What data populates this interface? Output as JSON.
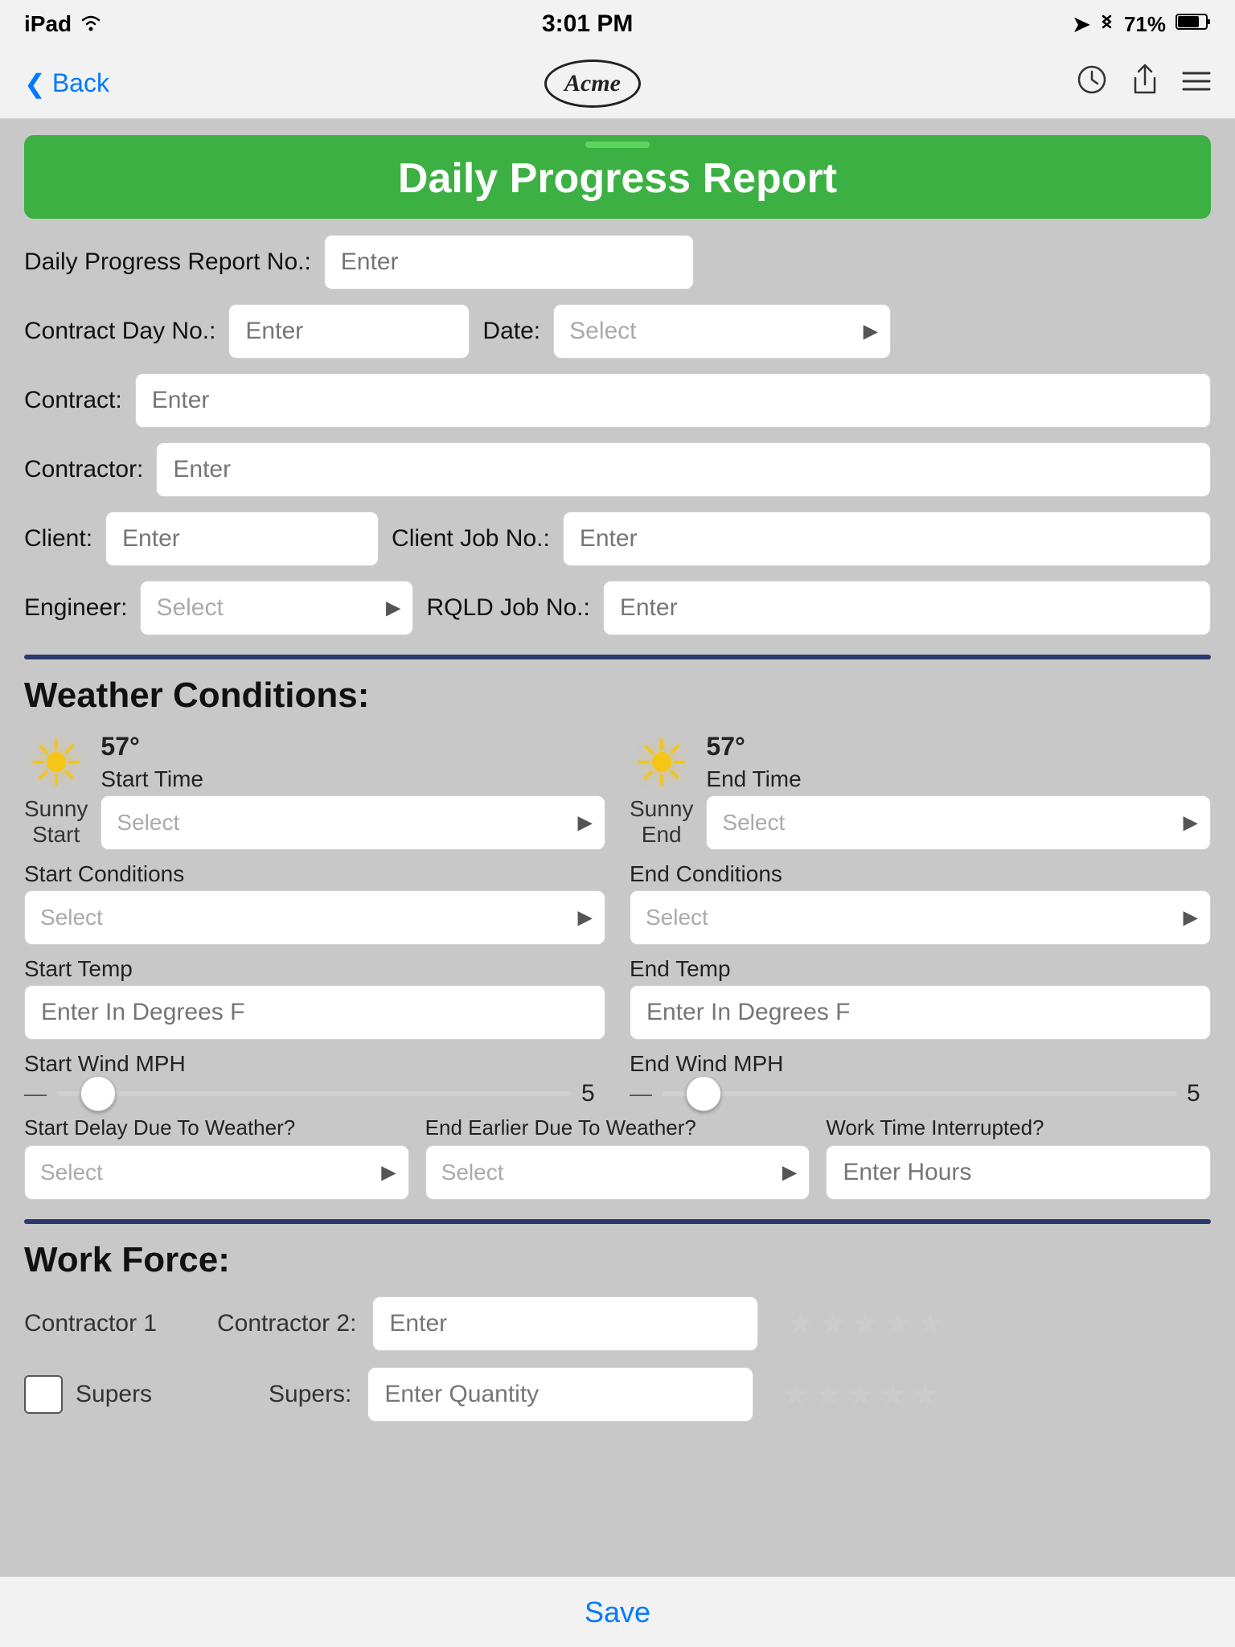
{
  "status_bar": {
    "carrier": "iPad",
    "wifi_icon": "wifi",
    "time": "3:01 PM",
    "location_icon": "➤",
    "bluetooth_icon": "Bluetooth",
    "battery": "71%"
  },
  "nav": {
    "back_label": "Back",
    "logo_text": "Acme",
    "history_icon": "clock",
    "share_icon": "share",
    "menu_icon": "menu"
  },
  "header": {
    "title": "Daily Progress Report",
    "notch_visible": true
  },
  "form": {
    "dpr_no_label": "Daily Progress Report No.:",
    "dpr_no_placeholder": "Enter",
    "contract_day_label": "Contract Day No.:",
    "contract_day_placeholder": "Enter",
    "date_label": "Date:",
    "date_placeholder": "Select",
    "contract_label": "Contract:",
    "contract_placeholder": "Enter",
    "contractor_label": "Contractor:",
    "contractor_placeholder": "Enter",
    "client_label": "Client:",
    "client_placeholder": "Enter",
    "client_job_label": "Client Job No.:",
    "client_job_placeholder": "Enter",
    "engineer_label": "Engineer:",
    "engineer_placeholder": "Select",
    "rqld_job_label": "RQLD Job No.:",
    "rqld_job_placeholder": "Enter"
  },
  "weather": {
    "section_title": "Weather Conditions:",
    "start": {
      "temp": "57°",
      "icon": "☀",
      "condition_label": "Sunny",
      "time_label": "Start",
      "start_time_label": "Start Time",
      "start_time_placeholder": "Select",
      "start_conditions_label": "Start Conditions",
      "start_conditions_placeholder": "Select",
      "start_temp_label": "Start Temp",
      "start_temp_placeholder": "Enter In Degrees F",
      "start_wind_label": "Start Wind MPH",
      "start_wind_value": "5"
    },
    "end": {
      "temp": "57°",
      "icon": "☀",
      "condition_label": "Sunny",
      "time_label": "End",
      "end_time_label": "End Time",
      "end_time_placeholder": "Select",
      "end_conditions_label": "End Conditions",
      "end_conditions_placeholder": "Select",
      "end_temp_label": "End Temp",
      "end_temp_placeholder": "Enter In Degrees F",
      "end_wind_label": "End Wind MPH",
      "end_wind_value": "5"
    },
    "delay": {
      "start_delay_label": "Start Delay Due To Weather?",
      "start_delay_placeholder": "Select",
      "end_earlier_label": "End Earlier Due To Weather?",
      "end_earlier_placeholder": "Select",
      "work_interrupted_label": "Work Time Interrupted?",
      "work_interrupted_placeholder": "Enter Hours"
    }
  },
  "workforce": {
    "section_title": "Work Force:",
    "contractor1_label": "Contractor 1",
    "contractor2_label": "Contractor 2:",
    "contractor2_placeholder": "Enter",
    "supers_checkbox_label": "Supers",
    "supers_label": "Supers:",
    "supers_placeholder": "Enter Quantity",
    "stars": [
      "★",
      "★",
      "★",
      "★",
      "★"
    ]
  },
  "footer": {
    "save_label": "Save"
  }
}
